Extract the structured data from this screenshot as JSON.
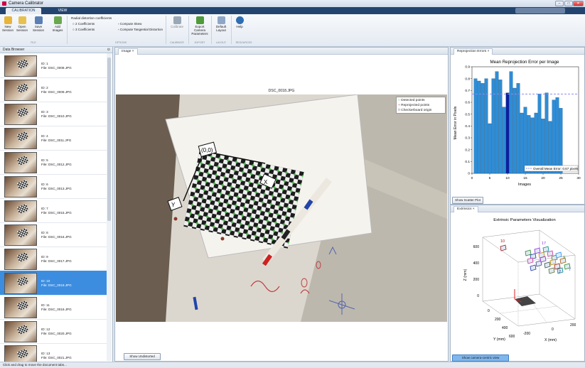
{
  "window": {
    "title": "Camera Calibrator"
  },
  "tabs": [
    {
      "label": "CALIBRATION"
    },
    {
      "label": "VIEW"
    }
  ],
  "ribbon": {
    "buttons": [
      {
        "label": "New Session",
        "color": "#e6b53a"
      },
      {
        "label": "Open Session",
        "color": "#e6c14f"
      },
      {
        "label": "Save Session",
        "color": "#5a7fb5"
      },
      {
        "label": "Add Images",
        "color": "#6aa84f"
      },
      {
        "label": "Calibrate",
        "color": "#9aa7b6"
      },
      {
        "label": "Export Camera Parameters",
        "color": "#4f9a3a"
      },
      {
        "label": "Default Layout",
        "color": "#8fa7c7"
      },
      {
        "label": "Help",
        "color": "#2f6db3"
      }
    ],
    "options": {
      "radial_title": "Radial distortion coefficients",
      "coeff2": "2 Coefficients",
      "coeff3": "3 Coefficients",
      "skew": "Compute Skew",
      "tangential": "Compute Tangential Distortion"
    },
    "groups": [
      "FILE",
      "OPTIONS",
      "CALIBRATE",
      "EXPORT",
      "LAYOUT",
      "RESOURCES"
    ]
  },
  "data_browser": {
    "title": "Data Browser",
    "items": [
      {
        "id": "ID: 1",
        "file": "File: DSC_0008.JPG"
      },
      {
        "id": "ID: 2",
        "file": "File: DSC_0009.JPG"
      },
      {
        "id": "ID: 3",
        "file": "File: DSC_0010.JPG"
      },
      {
        "id": "ID: 4",
        "file": "File: DSC_0011.JPG"
      },
      {
        "id": "ID: 5",
        "file": "File: DSC_0012.JPG"
      },
      {
        "id": "ID: 6",
        "file": "File: DSC_0013.JPG"
      },
      {
        "id": "ID: 7",
        "file": "File: DSC_0015.JPG"
      },
      {
        "id": "ID: 8",
        "file": "File: DSC_0016.JPG"
      },
      {
        "id": "ID: 9",
        "file": "File: DSC_0017.JPG"
      },
      {
        "id": "ID: 10",
        "file": "File: DSC_0018.JPG"
      },
      {
        "id": "ID: 11",
        "file": "File: DSC_0019.JPG"
      },
      {
        "id": "ID: 12",
        "file": "File: DSC_0020.JPG"
      },
      {
        "id": "ID: 13",
        "file": "File: DSC_0021.JPG"
      }
    ],
    "selected_index": 9
  },
  "image_panel": {
    "tab": "Image",
    "image_title": "DSC_0018.JPG",
    "legend": [
      "Detected points",
      "Reprojected points",
      "Checkerboard origin"
    ],
    "origin_label": "(0,0)",
    "x_label": "X",
    "y_label": "Y",
    "show_undistorted": "Show Undistorted"
  },
  "reprojection": {
    "tab": "Reprojection Errors",
    "show_scatter": "Show Scatter Plot",
    "chart_data": {
      "type": "bar",
      "title": "Mean Reprojection Error per Image",
      "xlabel": "Images",
      "ylabel": "Mean Error in Pixels",
      "xlim": [
        0,
        30
      ],
      "ylim": [
        0,
        0.9
      ],
      "xticks": [
        0,
        5,
        10,
        15,
        20,
        25,
        30
      ],
      "yticks": [
        0,
        0.1,
        0.2,
        0.3,
        0.4,
        0.5,
        0.6,
        0.7,
        0.8,
        0.9
      ],
      "categories": [
        1,
        2,
        3,
        4,
        5,
        6,
        7,
        8,
        9,
        10,
        11,
        12,
        13,
        14,
        15,
        16,
        17,
        18,
        19,
        20,
        21,
        22,
        23,
        24,
        25
      ],
      "values": [
        0.8,
        0.78,
        0.76,
        0.8,
        0.42,
        0.8,
        0.86,
        0.79,
        0.56,
        0.68,
        0.86,
        0.72,
        0.76,
        0.51,
        0.56,
        0.49,
        0.47,
        0.51,
        0.67,
        0.46,
        0.68,
        0.44,
        0.62,
        0.64,
        0.55
      ],
      "selected": 10,
      "mean_value": 0.67,
      "mean_label": "Overall Mean Error: 0.67 pixels",
      "bar_color": "#2e8dd6",
      "selected_color": "#0a1f9e",
      "mean_color": "#8a8cf0"
    }
  },
  "extrinsics": {
    "tab": "Extrinsics",
    "title": "Extrinsic Parameters Visualization",
    "zlabel": "Z (mm)",
    "ylabel": "Y (mm)",
    "xlabel": "X (mm)",
    "zticks": [
      "600",
      "400",
      "200",
      "0"
    ],
    "yticks": [
      "0",
      "200",
      "400",
      "600"
    ],
    "xticks": [
      "-200",
      "0",
      "200"
    ],
    "labels": [
      "10",
      "17",
      "9",
      "7",
      "2"
    ],
    "show_camera_centric": "Show camera-centric view"
  },
  "statusbar": {
    "text": "Click and drag to move the document tabs..."
  }
}
